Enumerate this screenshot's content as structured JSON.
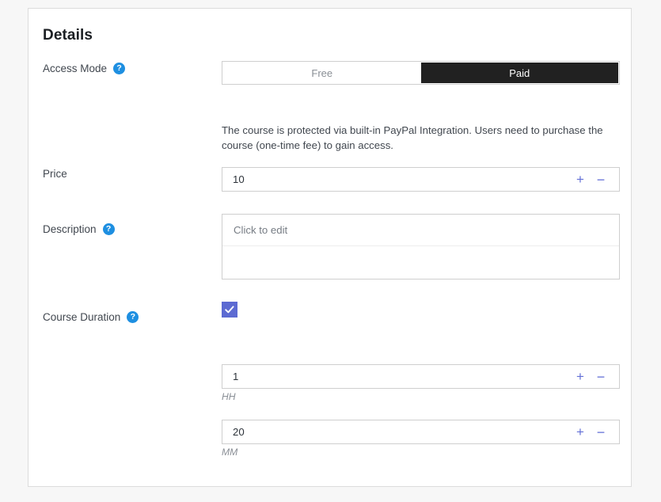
{
  "card": {
    "title": "Details"
  },
  "access_mode": {
    "label": "Access Mode",
    "help_icon": "help-circle-icon",
    "options": [
      {
        "label": "Free",
        "selected": false
      },
      {
        "label": "Paid",
        "selected": true
      }
    ],
    "selected": "Paid",
    "description": "The course is protected via built-in PayPal Integration. Users need to purchase the course (one-time fee) to gain access."
  },
  "price": {
    "label": "Price",
    "value": "10",
    "increment_label": "+",
    "decrement_label": "−"
  },
  "description": {
    "label": "Description",
    "help_icon": "help-circle-icon",
    "placeholder": "Click to edit",
    "value": ""
  },
  "course_duration": {
    "label": "Course Duration",
    "help_icon": "help-circle-icon",
    "enabled": true,
    "checkmark_icon": "check-icon",
    "hours": {
      "value": "1",
      "unit_hint": "HH",
      "increment_label": "+",
      "decrement_label": "−"
    },
    "minutes": {
      "value": "20",
      "unit_hint": "MM",
      "increment_label": "+",
      "decrement_label": "−"
    }
  },
  "colors": {
    "accent_stepper": "#6370d6",
    "checkbox_fill": "#5c6ad2",
    "help_icon_blue": "#1e8fe1",
    "active_segment": "#212121",
    "page_background": "#f7f7f7",
    "card_background": "#ffffff",
    "border": "#cfcfcf"
  },
  "icons": {
    "help": "?",
    "check": "check-icon"
  }
}
